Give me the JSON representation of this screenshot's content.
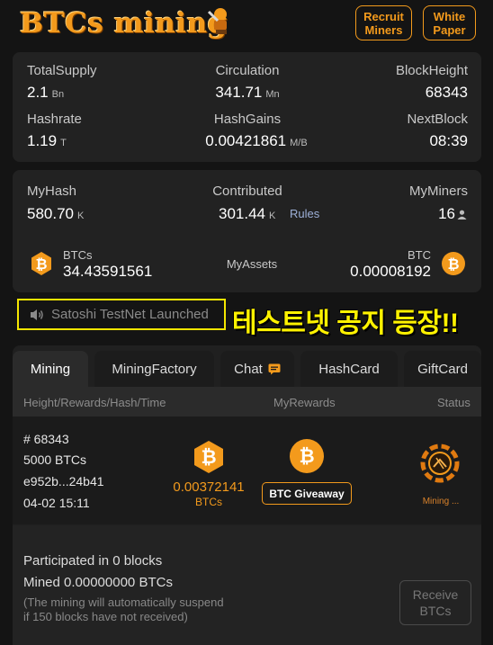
{
  "header": {
    "logo_text": "BTCs mining",
    "recruit_label": "Recruit\nMiners",
    "whitepaper_label": "White\nPaper"
  },
  "stats": {
    "total_supply_label": "TotalSupply",
    "total_supply_value": "2.1",
    "total_supply_unit": "Bn",
    "circulation_label": "Circulation",
    "circulation_value": "341.71",
    "circulation_unit": "Mn",
    "block_height_label": "BlockHeight",
    "block_height_value": "68343",
    "hashrate_label": "Hashrate",
    "hashrate_value": "1.19",
    "hashrate_unit": "T",
    "hash_gains_label": "HashGains",
    "hash_gains_value": "0.00421861",
    "hash_gains_unit": "M/B",
    "next_block_label": "NextBlock",
    "next_block_value": "08:39"
  },
  "mine": {
    "my_hash_label": "MyHash",
    "my_hash_value": "580.70",
    "my_hash_unit": "K",
    "contributed_label": "Contributed",
    "contributed_value": "301.44",
    "contributed_unit": "K",
    "rules_label": "Rules",
    "my_miners_label": "MyMiners",
    "my_miners_value": "16",
    "btcs_label": "BTCs",
    "btcs_value": "34.43591561",
    "my_assets_label": "MyAssets",
    "btc_label": "BTC",
    "btc_value": "0.00008192"
  },
  "announcement": {
    "text": "Satoshi TestNet Launched",
    "overlay_text": "테스트넷 공지 등장!!"
  },
  "tabs": [
    {
      "label": "Mining"
    },
    {
      "label": "MiningFactory"
    },
    {
      "label": "Chat"
    },
    {
      "label": "HashCard"
    },
    {
      "label": "GiftCard"
    }
  ],
  "table": {
    "col1": "Height/Rewards/Hash/Time",
    "col2": "MyRewards",
    "col3": "Status"
  },
  "block": {
    "height": "# 68343",
    "rewards": "5000 BTCs",
    "hash": "e952b...24b41",
    "time": "04-02 15:11",
    "reward_value": "0.00372141",
    "reward_unit": "BTCs",
    "giveaway_label": "BTC Giveaway",
    "status_label": "Mining ..."
  },
  "summary": {
    "participated": "Participated in 0 blocks",
    "mined": "Mined 0.00000000 BTCs",
    "note_line1": "(The mining will automatically suspend",
    "note_line2": "if 150 blocks have not received)",
    "receive_label": "Receive\nBTCs"
  },
  "colors": {
    "accent": "#f39a1c",
    "background": "#141414",
    "highlight": "#fff200"
  }
}
